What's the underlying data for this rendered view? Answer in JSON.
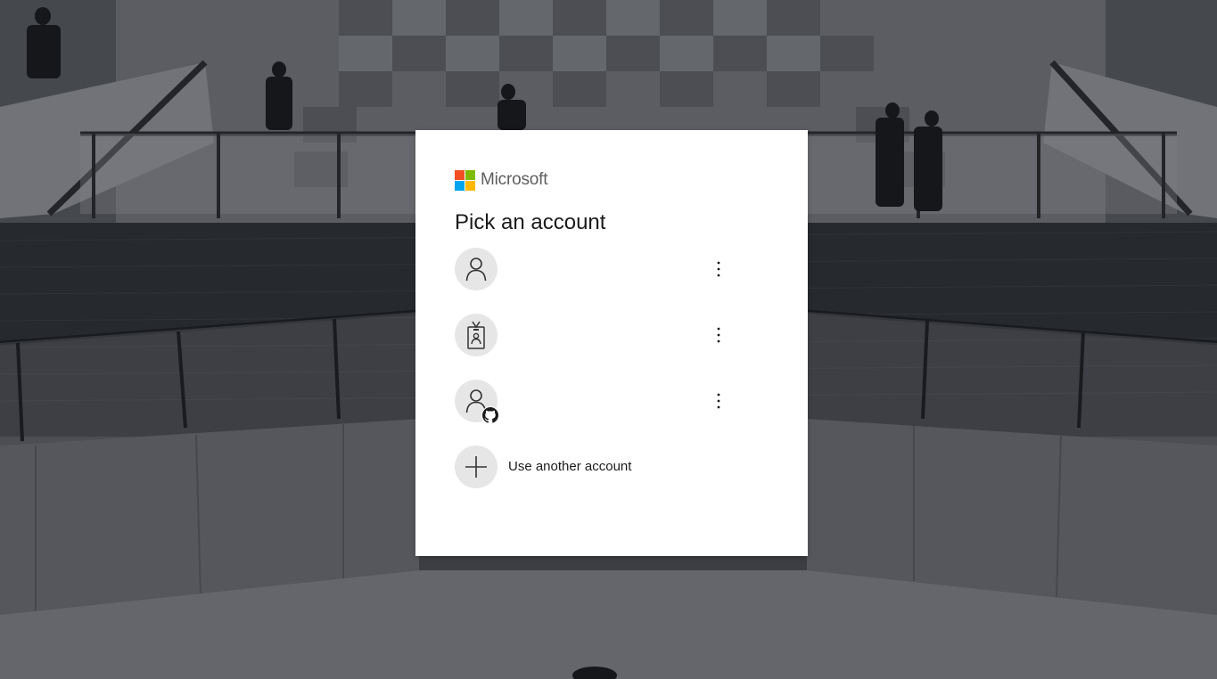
{
  "brand": {
    "name": "Microsoft",
    "logo_colors": [
      "#f25022",
      "#7fba00",
      "#00a4ef",
      "#ffb900"
    ]
  },
  "dialog": {
    "title": "Pick an account"
  },
  "accounts": [
    {
      "label": "",
      "icon": "person-icon",
      "menu_icon": "more-options-icon"
    },
    {
      "label": "",
      "icon": "work-badge-icon",
      "menu_icon": "more-options-icon"
    },
    {
      "label": "",
      "icon": "person-icon",
      "badge_icon": "github-icon",
      "menu_icon": "more-options-icon"
    }
  ],
  "use_another": {
    "label": "Use another account",
    "icon": "plus-icon"
  },
  "theme": {
    "dialog_bg": "#ffffff",
    "avatar_bg": "#e6e6e6",
    "text_color": "#1b1b1b"
  }
}
